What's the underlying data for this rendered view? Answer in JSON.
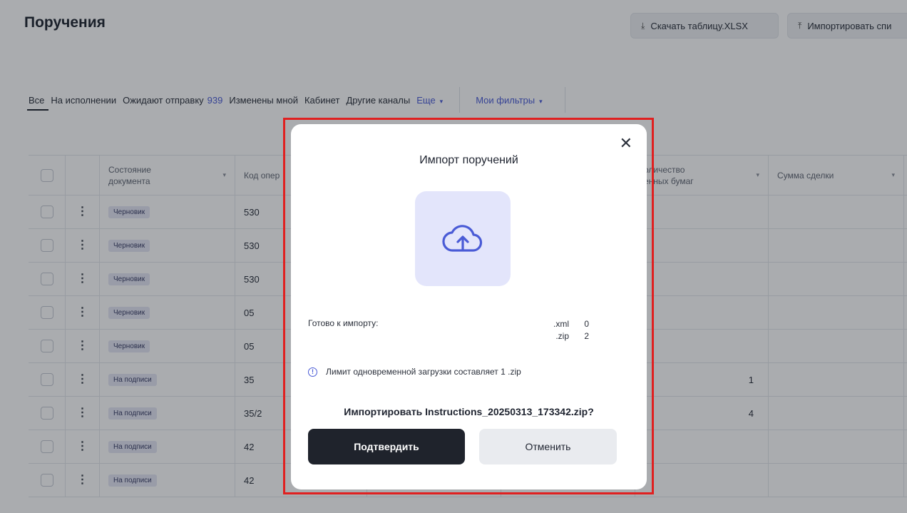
{
  "header": {
    "title": "Поручения",
    "download_label": "Скачать таблицу.XLSX",
    "import_label": "Импортировать спи"
  },
  "tabs": [
    {
      "label": "Все"
    },
    {
      "label": "На исполнении"
    },
    {
      "label": "Ожидают отправку",
      "count": "939"
    },
    {
      "label": "Изменены мной"
    },
    {
      "label": "Кабинет"
    },
    {
      "label": "Другие каналы"
    },
    {
      "label": "Еще"
    }
  ],
  "filters_label": "Мои фильтры",
  "table": {
    "columns": {
      "state": "Состояние документа",
      "code": "Код опер",
      "qty": "оличество\nенных бумаг",
      "sum": "Сумма сделки"
    },
    "rows": [
      {
        "state": "Черновик",
        "code": "530",
        "qty": ""
      },
      {
        "state": "Черновик",
        "code": "530",
        "qty": ""
      },
      {
        "state": "Черновик",
        "code": "530",
        "qty": ""
      },
      {
        "state": "Черновик",
        "code": "05",
        "qty": ""
      },
      {
        "state": "Черновик",
        "code": "05",
        "qty": ""
      },
      {
        "state": "На подписи",
        "code": "35",
        "qty": "1"
      },
      {
        "state": "На подписи",
        "code": "35/2",
        "qty": "4"
      },
      {
        "state": "На подписи",
        "code": "42",
        "qty": ""
      },
      {
        "state": "На подписи",
        "code": "42",
        "qty": ""
      }
    ]
  },
  "modal": {
    "title": "Импорт поручений",
    "ready_label": "Готово к импорту:",
    "extensions": [
      {
        "ext": ".xml",
        "count": "0"
      },
      {
        "ext": ".zip",
        "count": "2"
      }
    ],
    "limit_text": "Лимит одновременной загрузки составляет 1 .zip",
    "question": "Импортировать Instructions_20250313_173342.zip?",
    "confirm_label": "Подтвердить",
    "cancel_label": "Отменить"
  },
  "colors": {
    "accent": "#4a5bd6",
    "highlight": "#e02020",
    "primary_button": "#1f232c"
  }
}
